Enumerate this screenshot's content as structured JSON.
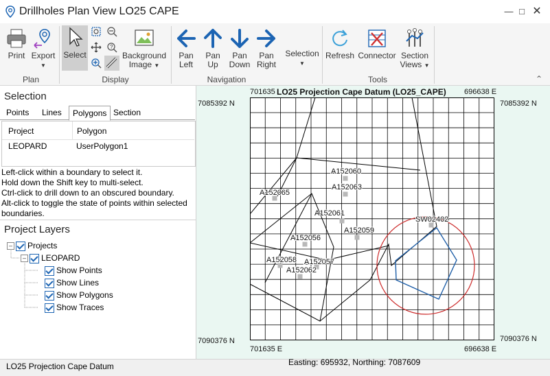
{
  "window": {
    "title": "Drillholes Plan View LO25 CAPE",
    "minimize_icon": "minimize-icon",
    "maximize_icon": "maximize-icon",
    "close_icon": "close-icon"
  },
  "ribbon": {
    "buttons": {
      "print": "Print",
      "export": "Export",
      "select": "Select",
      "background_image_1": "Background",
      "background_image_2": "Image",
      "pan_left_1": "Pan",
      "pan_left_2": "Left",
      "pan_up_1": "Pan",
      "pan_up_2": "Up",
      "pan_down_1": "Pan",
      "pan_down_2": "Down",
      "pan_right_1": "Pan",
      "pan_right_2": "Right",
      "selection": "Selection",
      "refresh": "Refresh",
      "connector": "Connector",
      "section_views_1": "Section",
      "section_views_2": "Views"
    },
    "groups": {
      "plan": "Plan",
      "display": "Display",
      "navigation": "Navigation",
      "tools": "Tools"
    }
  },
  "selection_panel": {
    "title": "Selection",
    "tabs": [
      "Points",
      "Lines",
      "Polygons",
      "Section"
    ],
    "active_tab": "Polygons",
    "columns": [
      "Project",
      "Polygon"
    ],
    "rows": [
      [
        "LEOPARD",
        "UserPolygon1"
      ]
    ],
    "help": [
      "Left-click within a boundary to select it.",
      "Hold down the Shift key to multi-select.",
      "Ctrl-click to drill down to an obscured boundary.",
      "Alt-click to toggle the state of points within selected",
      "boundaries."
    ]
  },
  "layers_panel": {
    "title": "Project Layers",
    "root": "Projects",
    "project": "LEOPARD",
    "items": [
      "Show Points",
      "Show Lines",
      "Show Polygons",
      "Show Traces"
    ]
  },
  "map": {
    "title": "LO25 Projection Cape Datum (LO25_CAPE)",
    "easting_min_top": "701635",
    "easting_max_top": "696638 E",
    "easting_min_bottom": "701635 E",
    "easting_max_bottom": "696638 E",
    "northing_top_left": "7085392 N",
    "northing_top_right": "7085392 N",
    "northing_bottom_left": "7090376 N",
    "northing_bottom_right": "7090376 N",
    "points": [
      {
        "label": "A152060"
      },
      {
        "label": "A152063"
      },
      {
        "label": "A152065"
      },
      {
        "label": "A152061"
      },
      {
        "label": "A152059"
      },
      {
        "label": "SW02402"
      },
      {
        "label": "A152056"
      },
      {
        "label": "A152058"
      },
      {
        "label": "A152057"
      },
      {
        "label": "A152062"
      }
    ],
    "colors": {
      "background": "#eaf7f2",
      "grid": "#000000",
      "polygon": "#1f5fa8",
      "circle": "#cc2a2a",
      "point": "#b8b8b8"
    }
  },
  "status": {
    "left": "LO25 Projection Cape Datum",
    "center": "Easting: 695932, Northing: 7087609"
  }
}
